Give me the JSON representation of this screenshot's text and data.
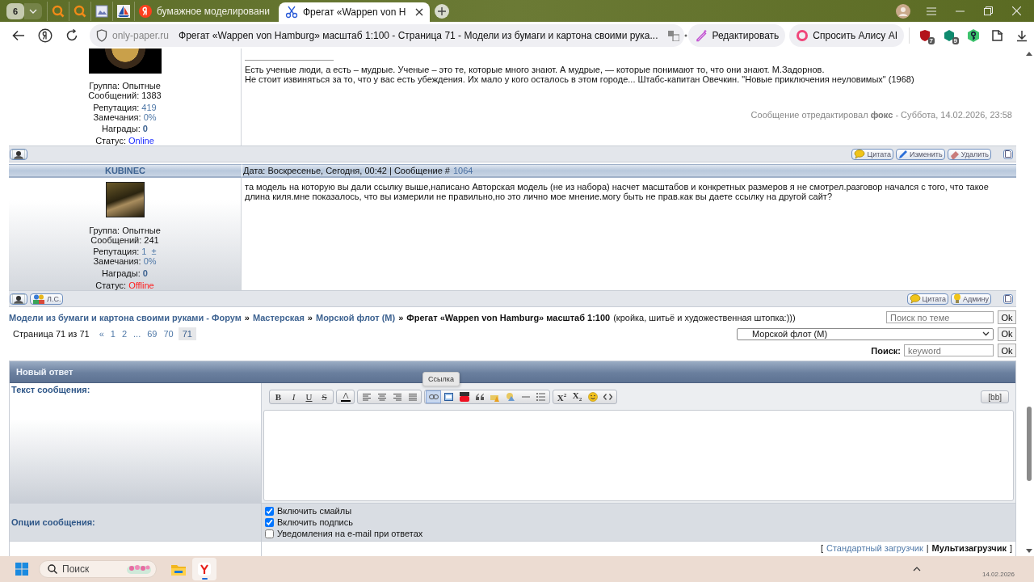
{
  "browser": {
    "tab_counter": "6",
    "tabs": [
      {
        "kind": "search",
        "selected": false
      },
      {
        "kind": "search",
        "selected": false
      },
      {
        "kind": "picture",
        "selected": false
      },
      {
        "kind": "sailboat",
        "selected": false
      },
      {
        "kind": "yandex",
        "title": "бумажное моделировани",
        "selected": false
      },
      {
        "kind": "scissors",
        "title": "Фрегат «Wappen von H",
        "selected": true
      }
    ],
    "address": {
      "domain": "only-paper.ru",
      "page_title": "Фрегат «Wappen von Hamburg» масштаб 1:100 - Страница 71 - Модели из бумаги и картона своими рука..."
    },
    "actions": [
      {
        "kind": "edit",
        "label": "Редактировать"
      },
      {
        "kind": "alice",
        "label": "Спросить Алису AI"
      }
    ],
    "extensions": [
      {
        "kind": "shield",
        "badge": "7"
      },
      {
        "kind": "cube",
        "badge": "9"
      },
      {
        "kind": "key"
      },
      {
        "kind": "tools"
      },
      {
        "kind": "download"
      }
    ]
  },
  "posts": [
    {
      "online": true,
      "stats": [
        {
          "kind": "plain",
          "label": "Группа:",
          "value": "Опытные"
        },
        {
          "kind": "plain",
          "label": "Сообщений:",
          "value": "1383"
        },
        {
          "kind": "link",
          "label": "Репутация:",
          "value": "419"
        },
        {
          "kind": "link",
          "label": "Замечания:",
          "value": "0%"
        },
        {
          "kind": "bold",
          "label": "Награды:",
          "value": "0"
        },
        {
          "kind": "status",
          "label": "Статус:",
          "value": "Online"
        }
      ],
      "signature": [
        "Есть ученые люди, а есть – мудрые. Ученые – это те, которые много знают. А мудрые, — которые понимают то, что они знают. М.Задорнов.",
        "Не стоит извиняться за то, что у вас есть убеждения. Их мало у кого осталось в этом городе... Штабс-капитан Овечкин. \"Новые приключения неуловимых\" (1968)"
      ],
      "edit_note": "Сообщение отредактировал **фокс** - Суббота, 14.02.2026, 23:58",
      "left_tools": [
        {
          "kind": "profile"
        }
      ],
      "right_tools": [
        {
          "kind": "quote",
          "label": "Цитата"
        },
        {
          "kind": "edit",
          "label": "Изменить"
        },
        {
          "kind": "delete",
          "label": "Удалить"
        }
      ]
    },
    {
      "online": false,
      "author": "KUBINEC",
      "date": "Дата: Воскресенье, Сегодня, 00:42 | Сообщение #",
      "number": "1064",
      "stats": [
        {
          "kind": "plain",
          "label": "Группа:",
          "value": "Опытные"
        },
        {
          "kind": "plain",
          "label": "Сообщений:",
          "value": "241"
        },
        {
          "kind": "link",
          "label": "Репутация:",
          "value": "1",
          "extra": "±"
        },
        {
          "kind": "link",
          "label": "Замечания:",
          "value": "0%"
        },
        {
          "kind": "bold",
          "label": "Награды:",
          "value": "0"
        },
        {
          "kind": "status",
          "label": "Статус:",
          "value": "Offline"
        }
      ],
      "text": "та модель на которую вы дали ссылку выше,написано Авторская модель (не из набора) насчет масштабов и конкретных размеров я не смотрел.разговор начался с того, что такое длина киля.мне показалось, что вы измерили не правильно,но это лично мое мнение.могу быть не прав.как вы даете ссылку на другой сайт?",
      "left_tools": [
        {
          "kind": "profile"
        },
        {
          "kind": "pm",
          "label": "Л.С."
        }
      ],
      "right_tools": [
        {
          "kind": "quote",
          "label": "Цитата"
        },
        {
          "kind": "admin",
          "label": "Админу"
        }
      ]
    }
  ],
  "nav": {
    "crumbs": [
      {
        "text": "Модели из бумаги и картона своими руками - Форум",
        "sep": "»"
      },
      {
        "text": "Мастерская",
        "sep": "»"
      },
      {
        "text": "Морской флот (М)",
        "sep": "»"
      }
    ],
    "current": "Фрегат «Wappen von Hamburg» масштаб 1:100",
    "description": "(кройка, шитьё и художественная штопка:)))",
    "topic_search": {
      "placeholder": "Поиск по теме",
      "button": "Ok"
    },
    "pagination": {
      "label": "Страница 71 из 71",
      "pages": [
        {
          "text": "«",
          "selected": false
        },
        {
          "text": "1",
          "selected": false
        },
        {
          "text": "2",
          "selected": false
        },
        {
          "text": "...",
          "selected": false
        },
        {
          "text": "69",
          "selected": false
        },
        {
          "text": "70",
          "selected": false
        },
        {
          "text": "71",
          "selected": true
        }
      ]
    },
    "forum_select": {
      "value": "Морской флот (М)",
      "button": "Ok"
    },
    "search": {
      "label": "Поиск:",
      "placeholder": "keyword",
      "button": "Ok"
    }
  },
  "reply": {
    "title": "Новый ответ",
    "message_label": "Текст сообщения:",
    "toolbar": [
      [
        {
          "kind": "bold",
          "label": "B",
          "hovered": false
        },
        {
          "kind": "italic",
          "label": "I",
          "hovered": false
        },
        {
          "kind": "underline",
          "label": "U",
          "hovered": false
        },
        {
          "kind": "strike",
          "label": "S",
          "hovered": false
        }
      ],
      [
        {
          "kind": "color",
          "hovered": false
        }
      ],
      [
        {
          "kind": "align-left",
          "hovered": false
        },
        {
          "kind": "align-center",
          "hovered": false
        },
        {
          "kind": "align-right",
          "hovered": false
        },
        {
          "kind": "justify",
          "hovered": false
        }
      ],
      [
        {
          "kind": "link",
          "hovered": true,
          "tooltip": "Ссылка"
        },
        {
          "kind": "image",
          "hovered": false
        },
        {
          "kind": "video",
          "hovered": false
        },
        {
          "kind": "quote",
          "hovered": false
        },
        {
          "kind": "hide",
          "hovered": false
        },
        {
          "kind": "spoiler",
          "hovered": false
        },
        {
          "kind": "hr",
          "hovered": false
        },
        {
          "kind": "list",
          "hovered": false
        }
      ],
      [
        {
          "kind": "sup",
          "label": "X$^{2}$",
          "hovered": false
        },
        {
          "kind": "sub",
          "label": "X$_{2}$",
          "hovered": false
        },
        {
          "kind": "smile",
          "hovered": false
        },
        {
          "kind": "code",
          "hovered": false
        }
      ]
    ],
    "bb_button": "[bb]",
    "options_label": "Опции сообщения:",
    "options": [
      {
        "label": "Включить смайлы",
        "checked": true
      },
      {
        "label": "Включить подпись",
        "checked": true
      },
      {
        "label": "Уведомления на e-mail при ответах",
        "checked": false
      }
    ],
    "uploader": {
      "open": "[",
      "options": [
        {
          "label": "Стандартный загрузчик",
          "selected": false
        },
        {
          "label": "Мультизагрузчик",
          "selected": true
        }
      ],
      "separator": "|",
      "close": "]"
    }
  },
  "taskbar": {
    "search_placeholder": "Поиск",
    "date": "14.02.2026"
  }
}
